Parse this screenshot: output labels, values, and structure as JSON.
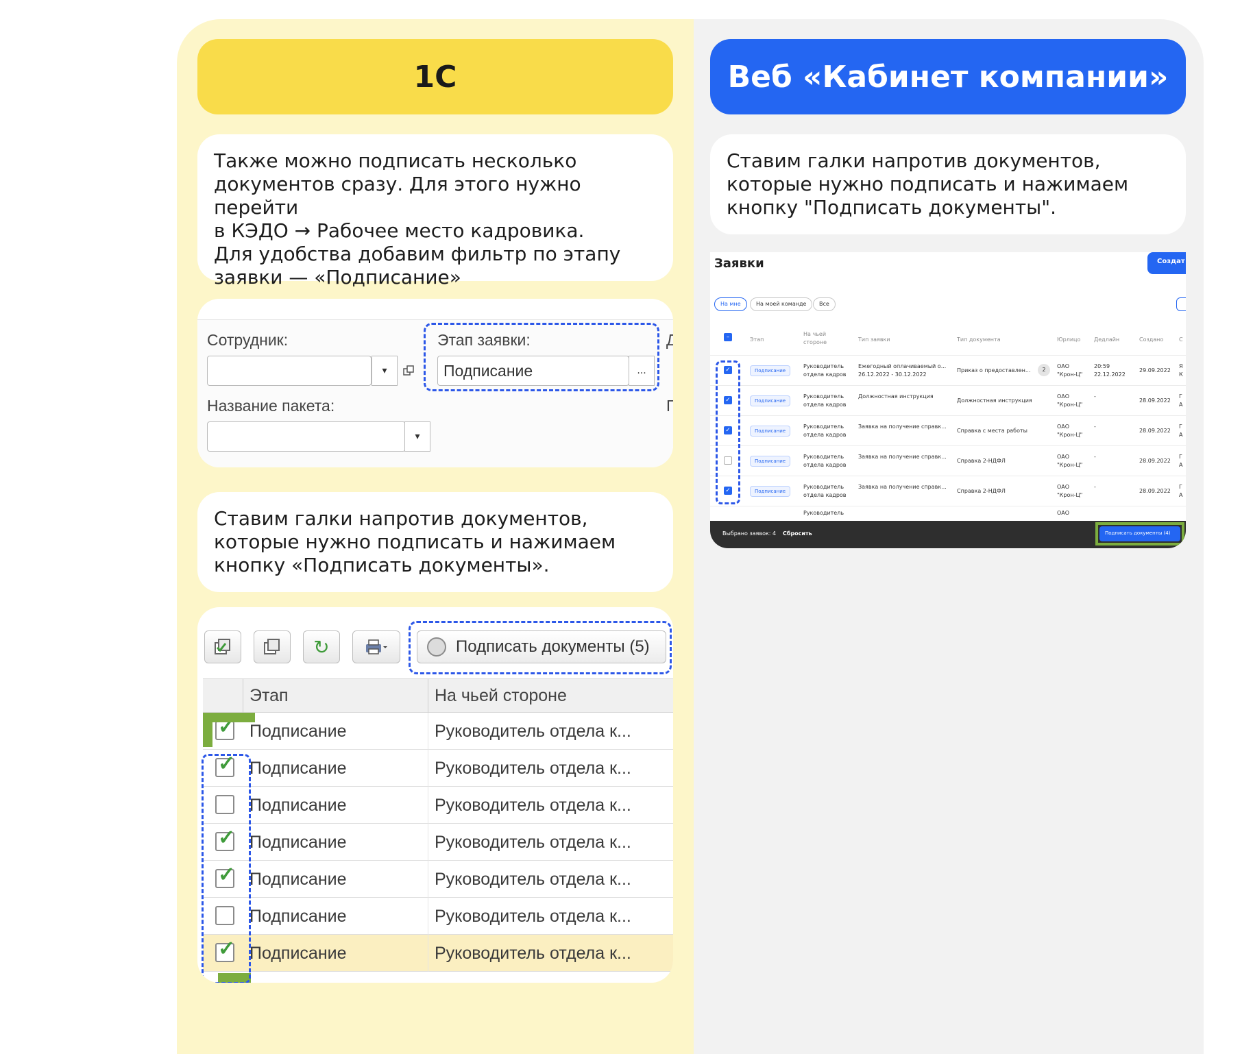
{
  "headers": {
    "left": "1С",
    "right": "Веб «Кабинет компании»"
  },
  "left": {
    "intro_text": "Также можно подписать несколько\nдокументов сразу. Для этого нужно перейти\nв КЭДО → Рабочее место кадровика.\nДля удобства добавим фильтр по этапу\nзаявки — «Подписание»",
    "filter": {
      "employee_label": "Сотрудник:",
      "employee_value": "",
      "stage_label": "Этап заявки:",
      "stage_value": "Подписание",
      "package_label": "Название пакета:",
      "package_value": "",
      "ellipsis": "...",
      "dropdown_arrow": "▾",
      "edge_label_1": "Д",
      "edge_label_2": "Г"
    },
    "step_text": "Ставим галки напротив документов,\nкоторые нужно подписать и нажимаем\nкнопку «Подписать документы».",
    "toolbar": {
      "sign_button": "Подписать документы (5)",
      "refresh_glyph": "↻"
    },
    "table": {
      "columns": [
        "Этап",
        "На чьей стороне"
      ],
      "rows": [
        {
          "stage": "Подписание",
          "side": "Руководитель отдела к...",
          "checked": true
        },
        {
          "stage": "Подписание",
          "side": "Руководитель отдела к...",
          "checked": true
        },
        {
          "stage": "Подписание",
          "side": "Руководитель отдела к...",
          "checked": false
        },
        {
          "stage": "Подписание",
          "side": "Руководитель отдела к...",
          "checked": true
        },
        {
          "stage": "Подписание",
          "side": "Руководитель отдела к...",
          "checked": true
        },
        {
          "stage": "Подписание",
          "side": "Руководитель отдела к...",
          "checked": false
        },
        {
          "stage": "Подписание",
          "side": "Руководитель отдела к...",
          "checked": true
        }
      ],
      "check_glyph": "✓"
    }
  },
  "right": {
    "step_text": "Ставим галки напротив документов,\nкоторые нужно подписать и нажимаем\nкнопку \"Подписать документы\".",
    "web": {
      "title": "Заявки",
      "create_button": "Создат",
      "filters": [
        "На мне",
        "На моей команде",
        "Все"
      ],
      "columns": [
        "Этап",
        "На чьей\nстороне",
        "Тип заявки",
        "Тип документа",
        "Юрлицо",
        "Дедлайн",
        "Создано",
        "С"
      ],
      "rows": [
        {
          "checked": true,
          "stage": "Подписание",
          "side": "Руководитель\nотдела кадров",
          "request": "Ежегодный оплачиваемый о...\n26.12.2022 - 30.12.2022",
          "doc": "Приказ о предоставлен...",
          "badge": "2",
          "entity": "ОАО\n\"Крон-Ц\"",
          "deadline": "20:59\n22.12.2022",
          "created": "29.09.2022",
          "extra": "Я\nК"
        },
        {
          "checked": true,
          "stage": "Подписание",
          "side": "Руководитель\nотдела кадров",
          "request": "Должностная инструкция",
          "doc": "Должностная инструкция",
          "badge": "",
          "entity": "ОАО\n\"Крон-Ц\"",
          "deadline": "-",
          "created": "28.09.2022",
          "extra": "Г\nА"
        },
        {
          "checked": true,
          "stage": "Подписание",
          "side": "Руководитель\nотдела кадров",
          "request": "Заявка на получение справк...",
          "doc": "Справка с места работы",
          "badge": "",
          "entity": "ОАО\n\"Крон-Ц\"",
          "deadline": "-",
          "created": "28.09.2022",
          "extra": "Г\nА"
        },
        {
          "checked": false,
          "stage": "Подписание",
          "side": "Руководитель\nотдела кадров",
          "request": "Заявка на получение справк...",
          "doc": "Справка 2-НДФЛ",
          "badge": "",
          "entity": "ОАО\n\"Крон-Ц\"",
          "deadline": "-",
          "created": "28.09.2022",
          "extra": "Г\nА"
        },
        {
          "checked": true,
          "stage": "Подписание",
          "side": "Руководитель\nотдела кадров",
          "request": "Заявка на получение справк...",
          "doc": "Справка 2-НДФЛ",
          "badge": "",
          "entity": "ОАО\n\"Крон-Ц\"",
          "deadline": "-",
          "created": "28.09.2022",
          "extra": "Г\nА"
        }
      ],
      "partial_row": {
        "side": "Руководитель",
        "entity": "ОАО"
      },
      "footer_selected": "Выбрано заявок: 4",
      "footer_reset": "Сбросить",
      "footer_sign_button": "Подписать документы (4)"
    }
  },
  "colors": {
    "accent_yellow": "#f9dc4a",
    "accent_blue": "#2466f2",
    "dash_blue": "#2c57e8",
    "highlight_green": "#7cad3f"
  }
}
